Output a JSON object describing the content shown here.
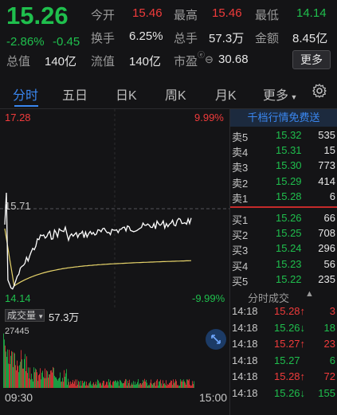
{
  "header": {
    "price": "15.26",
    "change_pct": "-2.86%",
    "change_abs": "-0.45",
    "mktcap_label": "总值",
    "mktcap_value": "140亿",
    "open_label": "今开",
    "open_value": "15.46",
    "high_label": "最高",
    "high_value": "15.46",
    "low_label": "最低",
    "low_value": "14.14",
    "turnover_label": "换手",
    "turnover_value": "6.25%",
    "hands_label": "总手",
    "hands_value": "57.3万",
    "amount_label": "金额",
    "amount_value": "8.45亿",
    "float_label": "流值",
    "float_value": "140亿",
    "pe_label": "市盈",
    "pe_value": "30.68",
    "more_button": "更多"
  },
  "tabs": [
    "分时",
    "五日",
    "日K",
    "周K",
    "月K",
    "更多"
  ],
  "chart": {
    "upper_price": "17.28",
    "upper_pct": "9.99%",
    "mid_price": "15.71",
    "lower_price": "14.14",
    "lower_pct": "-9.99%",
    "volume_label": "成交量",
    "volume_total": "57.3万",
    "volume_max": "27445",
    "time_start": "09:30",
    "time_end": "15:00",
    "colors": {
      "up": "#f03b3b",
      "down": "#1fbf4d",
      "price_line": "#ffffff",
      "avg_line": "#e6d36a"
    }
  },
  "order_book": {
    "header": "千档行情免费送",
    "asks": [
      {
        "label": "卖5",
        "price": "15.32",
        "volume": "535"
      },
      {
        "label": "卖4",
        "price": "15.31",
        "volume": "15"
      },
      {
        "label": "卖3",
        "price": "15.30",
        "volume": "773"
      },
      {
        "label": "卖2",
        "price": "15.29",
        "volume": "414"
      },
      {
        "label": "卖1",
        "price": "15.28",
        "volume": "6"
      }
    ],
    "bids": [
      {
        "label": "买1",
        "price": "15.26",
        "volume": "66"
      },
      {
        "label": "买2",
        "price": "15.25",
        "volume": "708"
      },
      {
        "label": "买3",
        "price": "15.24",
        "volume": "296"
      },
      {
        "label": "买4",
        "price": "15.23",
        "volume": "56"
      },
      {
        "label": "买5",
        "price": "15.22",
        "volume": "235"
      }
    ]
  },
  "trades": {
    "header": "分时成交",
    "rows": [
      {
        "time": "14:18",
        "price": "15.28↑",
        "volume": "3",
        "dir": "up"
      },
      {
        "time": "14:18",
        "price": "15.26↓",
        "volume": "18",
        "dir": "down"
      },
      {
        "time": "14:18",
        "price": "15.27↑",
        "volume": "23",
        "dir": "up"
      },
      {
        "time": "14:18",
        "price": "15.27",
        "volume": "6",
        "dir": "flat"
      },
      {
        "time": "14:18",
        "price": "15.28↑",
        "volume": "72",
        "dir": "up"
      },
      {
        "time": "14:18",
        "price": "15.26↓",
        "volume": "155",
        "dir": "down"
      }
    ]
  }
}
